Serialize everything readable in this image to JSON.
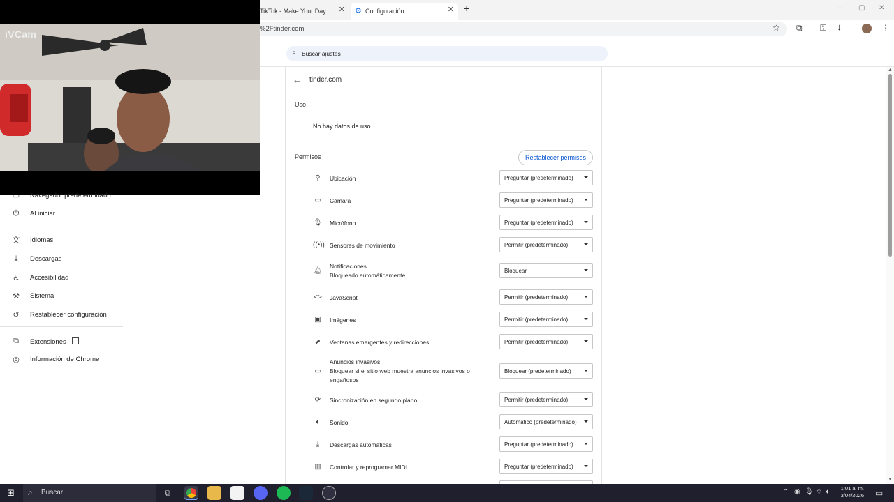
{
  "browser": {
    "tabs": [
      {
        "label": "TikTok - Make Your Day",
        "active": false
      },
      {
        "label": "Configuración",
        "active": true
      }
    ],
    "new_tab": "+",
    "address": "%2Ftinder.com",
    "window_controls": {
      "minimize": "–",
      "maximize": "▢",
      "close": "✕"
    }
  },
  "camera_overlay": {
    "brand": "iVCam"
  },
  "settings": {
    "search_placeholder": "Buscar ajustes",
    "sidebar": {
      "items": [
        {
          "label": "Navegador predeterminado",
          "icon": "browser-icon"
        },
        {
          "label": "Al iniciar",
          "icon": "power-icon"
        },
        {
          "label": "Idiomas",
          "icon": "translate-icon"
        },
        {
          "label": "Descargas",
          "icon": "download-icon"
        },
        {
          "label": "Accesibilidad",
          "icon": "accessibility-icon"
        },
        {
          "label": "Sistema",
          "icon": "wrench-icon"
        },
        {
          "label": "Restablecer configuración",
          "icon": "reset-icon"
        },
        {
          "label": "Extensiones",
          "icon": "puzzle-icon"
        },
        {
          "label": "Información de Chrome",
          "icon": "chrome-icon"
        }
      ]
    },
    "site": {
      "name": "tinder.com",
      "usage_heading": "Uso",
      "usage_text": "No hay datos de uso",
      "permissions_heading": "Permisos",
      "reset_button": "Restablecer permisos",
      "permissions": [
        {
          "name": "Ubicación",
          "desc": "",
          "value": "Preguntar (predeterminado)",
          "icon": "location-icon"
        },
        {
          "name": "Cámara",
          "desc": "",
          "value": "Preguntar (predeterminado)",
          "icon": "camera-icon"
        },
        {
          "name": "Micrófono",
          "desc": "",
          "value": "Preguntar (predeterminado)",
          "icon": "microphone-icon"
        },
        {
          "name": "Sensores de movimiento",
          "desc": "",
          "value": "Permitir (predeterminado)",
          "icon": "sensors-icon"
        },
        {
          "name": "Notificaciones",
          "desc": "Bloqueado automáticamente",
          "value": "Bloquear",
          "icon": "bell-icon"
        },
        {
          "name": "JavaScript",
          "desc": "",
          "value": "Permitir (predeterminado)",
          "icon": "code-icon"
        },
        {
          "name": "Imágenes",
          "desc": "",
          "value": "Permitir (predeterminado)",
          "icon": "image-icon"
        },
        {
          "name": "Ventanas emergentes y redirecciones",
          "desc": "",
          "value": "Permitir (predeterminado)",
          "icon": "popup-icon"
        },
        {
          "name": "Anuncios invasivos",
          "desc": "Bloquear si el sitio web muestra anuncios invasivos o engañosos",
          "value": "Bloquear (predeterminado)",
          "icon": "ads-icon"
        },
        {
          "name": "Sincronización en segundo plano",
          "desc": "",
          "value": "Permitir (predeterminado)",
          "icon": "sync-icon"
        },
        {
          "name": "Sonido",
          "desc": "",
          "value": "Automático (predeterminado)",
          "icon": "speaker-icon"
        },
        {
          "name": "Descargas automáticas",
          "desc": "",
          "value": "Preguntar (predeterminado)",
          "icon": "download-icon"
        },
        {
          "name": "Controlar y reprogramar MIDI",
          "desc": "",
          "value": "Preguntar (predeterminado)",
          "icon": "midi-icon"
        }
      ]
    }
  },
  "taskbar": {
    "search_placeholder": "Buscar",
    "time": "1:01 a. m.",
    "date": "3/04/2026",
    "apps": [
      "task-view",
      "chrome",
      "file-explorer",
      "store",
      "discord",
      "spotify",
      "steam",
      "app"
    ]
  }
}
